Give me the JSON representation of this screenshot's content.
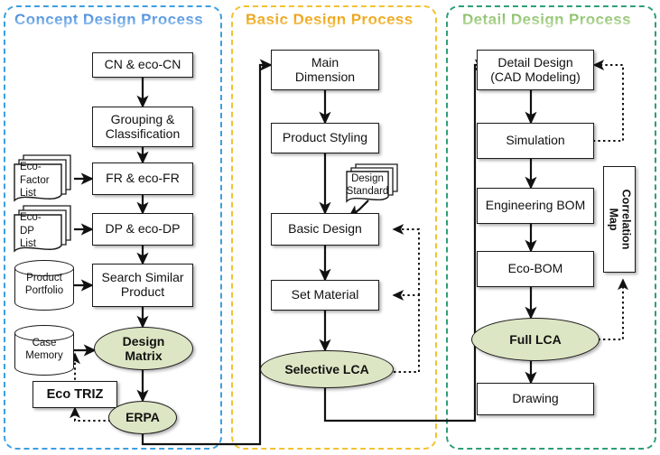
{
  "panels": [
    {
      "id": "concept",
      "title": "Concept Design Process",
      "border_color": "#3d9fe0"
    },
    {
      "id": "basic",
      "title": "Basic Design Process",
      "border_color": "#f2c231"
    },
    {
      "id": "detail",
      "title": "Detail Design Process",
      "border_color": "#2e9e78"
    }
  ],
  "concept": {
    "nodes": {
      "cn": "CN & eco-CN",
      "grouping": "Grouping &\nClassification",
      "fr": "FR & eco-FR",
      "dp": "DP & eco-DP",
      "search": "Search Similar\nProduct",
      "design_matrix": "Design\nMatrix",
      "erpa": "ERPA",
      "eco_triz": "Eco TRIZ"
    },
    "stores": {
      "eco_factor_list": "Eco-\nFactor\nList",
      "eco_dp_list": "Eco-\nDP\nList",
      "product_portfolio": "Product\nPortfolio",
      "case_memory": "Case\nMemory"
    }
  },
  "basic": {
    "nodes": {
      "main_dimension": "Main\nDimension",
      "product_styling": "Product Styling",
      "basic_design": "Basic Design",
      "set_material": "Set Material",
      "selective_lca": "Selective LCA"
    },
    "stores": {
      "design_standard": "Design\nStandard"
    }
  },
  "detail": {
    "nodes": {
      "detail_design": "Detail Design\n(CAD Modeling)",
      "simulation": "Simulation",
      "engineering_bom": "Engineering BOM",
      "eco_bom": "Eco-BOM",
      "full_lca": "Full LCA",
      "drawing": "Drawing",
      "correlation_map": "Correlation\nMap"
    }
  },
  "colors": {
    "ellipse_fill": "#dde6c4",
    "node_stroke": "#1a1a1a",
    "concept_accent": "#3d9fe0",
    "basic_accent": "#f2c231",
    "detail_accent": "#2e9e78"
  }
}
